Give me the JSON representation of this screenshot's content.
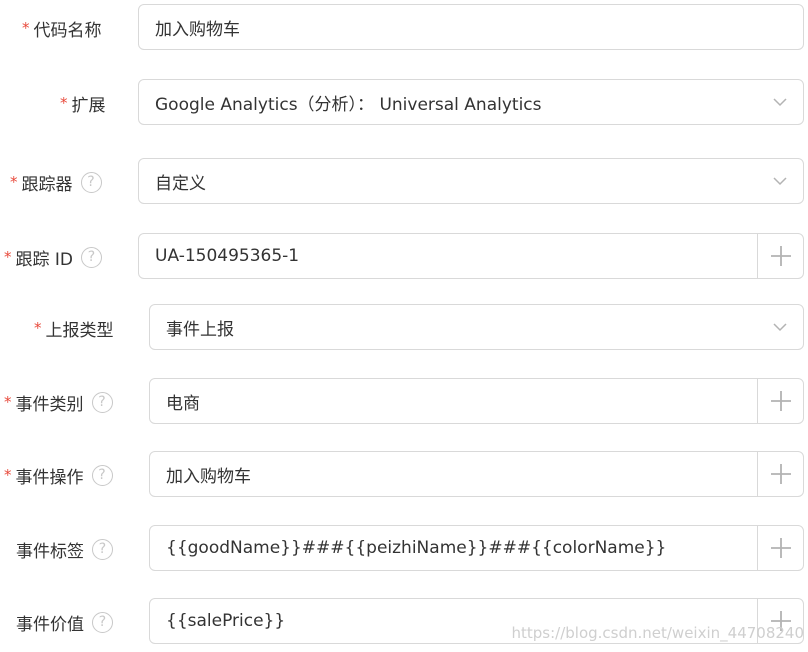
{
  "fields": [
    {
      "label": "代码名称",
      "required": "*",
      "value": "加入购物车"
    },
    {
      "label": "扩展",
      "required": "*",
      "value": "Google Analytics（分析）： Universal Analytics",
      "control_icon": "chevron-down-icon"
    },
    {
      "label": "跟踪器",
      "required": "*",
      "help": "?",
      "value": "自定义",
      "control_icon": "chevron-down-icon"
    },
    {
      "label": "跟踪 ID",
      "required": "*",
      "help": "?",
      "value": "UA-150495365-1",
      "control_icon": "plus-icon"
    },
    {
      "label": "上报类型",
      "required": "*",
      "value": "事件上报",
      "control_icon": "chevron-down-icon"
    },
    {
      "label": "事件类别",
      "required": "*",
      "help": "?",
      "value": "电商",
      "control_icon": "plus-icon"
    },
    {
      "label": "事件操作",
      "required": "*",
      "help": "?",
      "value": "加入购物车",
      "control_icon": "plus-icon"
    },
    {
      "label": "事件标签",
      "help": "?",
      "value": "{{goodName}}###{{peizhiName}}###{{colorName}}",
      "control_icon": "plus-icon"
    },
    {
      "label": "事件价值",
      "help": "?",
      "value": "{{salePrice}}",
      "control_icon": "plus-icon"
    }
  ],
  "watermark": "https://blog.csdn.net/weixin_44708240",
  "colors": {
    "required_asterisk": "#e84a3c",
    "border": "#d9d9d9",
    "icon": "#b3b3b3",
    "text": "#333333"
  }
}
